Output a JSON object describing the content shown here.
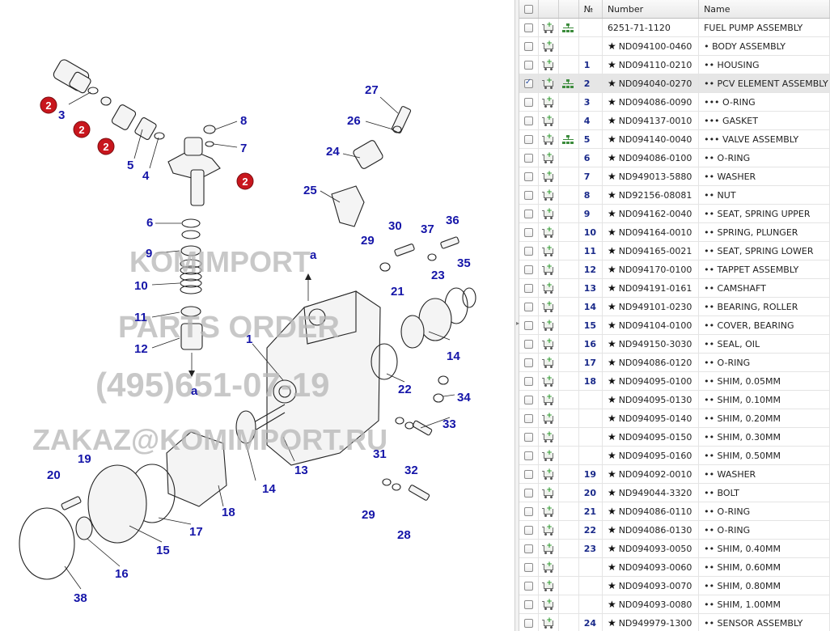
{
  "diagram": {
    "watermark_lines": [
      "KOMIMPORT",
      "PARTS ORDER",
      "(495)651-07-19",
      "ZAKAZ@KOMIMPORT.RU"
    ],
    "badge_text": "2",
    "letter_a": "a",
    "callouts": [
      "1",
      "2",
      "3",
      "4",
      "5",
      "6",
      "7",
      "8",
      "9",
      "10",
      "11",
      "12",
      "13",
      "14",
      "15",
      "16",
      "17",
      "18",
      "19",
      "20",
      "21",
      "22",
      "23",
      "24",
      "25",
      "26",
      "27",
      "28",
      "29",
      "30",
      "31",
      "32",
      "33",
      "34",
      "35",
      "36",
      "37",
      "38"
    ]
  },
  "table": {
    "columns": {
      "no": "№",
      "number": "Number",
      "name": "Name"
    },
    "rows": [
      {
        "checked": false,
        "tree": true,
        "no": "",
        "star": false,
        "number": "6251-71-1120",
        "name": "FUEL PUMP ASSEMBLY"
      },
      {
        "checked": false,
        "tree": false,
        "no": "",
        "star": true,
        "number": "ND094100-0460",
        "name": "• BODY ASSEMBLY"
      },
      {
        "checked": false,
        "tree": false,
        "no": "1",
        "star": true,
        "number": "ND094110-0210",
        "name": "•• HOUSING"
      },
      {
        "checked": true,
        "tree": true,
        "no": "2",
        "star": true,
        "number": "ND094040-0270",
        "name": "•• PCV ELEMENT ASSEMBLY"
      },
      {
        "checked": false,
        "tree": false,
        "no": "3",
        "star": true,
        "number": "ND094086-0090",
        "name": "••• O-RING"
      },
      {
        "checked": false,
        "tree": false,
        "no": "4",
        "star": true,
        "number": "ND094137-0010",
        "name": "••• GASKET"
      },
      {
        "checked": false,
        "tree": true,
        "no": "5",
        "star": true,
        "number": "ND094140-0040",
        "name": "••• VALVE ASSEMBLY"
      },
      {
        "checked": false,
        "tree": false,
        "no": "6",
        "star": true,
        "number": "ND094086-0100",
        "name": "•• O-RING"
      },
      {
        "checked": false,
        "tree": false,
        "no": "7",
        "star": true,
        "number": "ND949013-5880",
        "name": "•• WASHER"
      },
      {
        "checked": false,
        "tree": false,
        "no": "8",
        "star": true,
        "number": "ND92156-08081",
        "name": "•• NUT"
      },
      {
        "checked": false,
        "tree": false,
        "no": "9",
        "star": true,
        "number": "ND094162-0040",
        "name": "•• SEAT, SPRING UPPER"
      },
      {
        "checked": false,
        "tree": false,
        "no": "10",
        "star": true,
        "number": "ND094164-0010",
        "name": "•• SPRING, PLUNGER"
      },
      {
        "checked": false,
        "tree": false,
        "no": "11",
        "star": true,
        "number": "ND094165-0021",
        "name": "•• SEAT, SPRING LOWER"
      },
      {
        "checked": false,
        "tree": false,
        "no": "12",
        "star": true,
        "number": "ND094170-0100",
        "name": "•• TAPPET ASSEMBLY"
      },
      {
        "checked": false,
        "tree": false,
        "no": "13",
        "star": true,
        "number": "ND094191-0161",
        "name": "•• CAMSHAFT"
      },
      {
        "checked": false,
        "tree": false,
        "no": "14",
        "star": true,
        "number": "ND949101-0230",
        "name": "•• BEARING, ROLLER"
      },
      {
        "checked": false,
        "tree": false,
        "no": "15",
        "star": true,
        "number": "ND094104-0100",
        "name": "•• COVER, BEARING"
      },
      {
        "checked": false,
        "tree": false,
        "no": "16",
        "star": true,
        "number": "ND949150-3030",
        "name": "•• SEAL, OIL"
      },
      {
        "checked": false,
        "tree": false,
        "no": "17",
        "star": true,
        "number": "ND094086-0120",
        "name": "•• O-RING"
      },
      {
        "checked": false,
        "tree": false,
        "no": "18",
        "star": true,
        "number": "ND094095-0100",
        "name": "•• SHIM, 0.05MM"
      },
      {
        "checked": false,
        "tree": false,
        "no": "",
        "star": true,
        "number": "ND094095-0130",
        "name": "•• SHIM, 0.10MM"
      },
      {
        "checked": false,
        "tree": false,
        "no": "",
        "star": true,
        "number": "ND094095-0140",
        "name": "•• SHIM, 0.20MM"
      },
      {
        "checked": false,
        "tree": false,
        "no": "",
        "star": true,
        "number": "ND094095-0150",
        "name": "•• SHIM, 0.30MM"
      },
      {
        "checked": false,
        "tree": false,
        "no": "",
        "star": true,
        "number": "ND094095-0160",
        "name": "•• SHIM, 0.50MM"
      },
      {
        "checked": false,
        "tree": false,
        "no": "19",
        "star": true,
        "number": "ND094092-0010",
        "name": "•• WASHER"
      },
      {
        "checked": false,
        "tree": false,
        "no": "20",
        "star": true,
        "number": "ND949044-3320",
        "name": "•• BOLT"
      },
      {
        "checked": false,
        "tree": false,
        "no": "21",
        "star": true,
        "number": "ND094086-0110",
        "name": "•• O-RING"
      },
      {
        "checked": false,
        "tree": false,
        "no": "22",
        "star": true,
        "number": "ND094086-0130",
        "name": "•• O-RING"
      },
      {
        "checked": false,
        "tree": false,
        "no": "23",
        "star": true,
        "number": "ND094093-0050",
        "name": "•• SHIM, 0.40MM"
      },
      {
        "checked": false,
        "tree": false,
        "no": "",
        "star": true,
        "number": "ND094093-0060",
        "name": "•• SHIM, 0.60MM"
      },
      {
        "checked": false,
        "tree": false,
        "no": "",
        "star": true,
        "number": "ND094093-0070",
        "name": "•• SHIM, 0.80MM"
      },
      {
        "checked": false,
        "tree": false,
        "no": "",
        "star": true,
        "number": "ND094093-0080",
        "name": "•• SHIM, 1.00MM"
      },
      {
        "checked": false,
        "tree": false,
        "no": "24",
        "star": true,
        "number": "ND949979-1300",
        "name": "•• SENSOR ASSEMBLY"
      }
    ]
  },
  "colors": {
    "callout": "#1515a8",
    "badge": "#c8161d",
    "selected_row": "#e6e6e6",
    "watermark": "#b9b9b9"
  },
  "icons": {
    "cart": "add-to-cart-icon",
    "tree": "tree-structure-icon",
    "star": "star-icon",
    "checkbox": "checkbox-icon"
  }
}
